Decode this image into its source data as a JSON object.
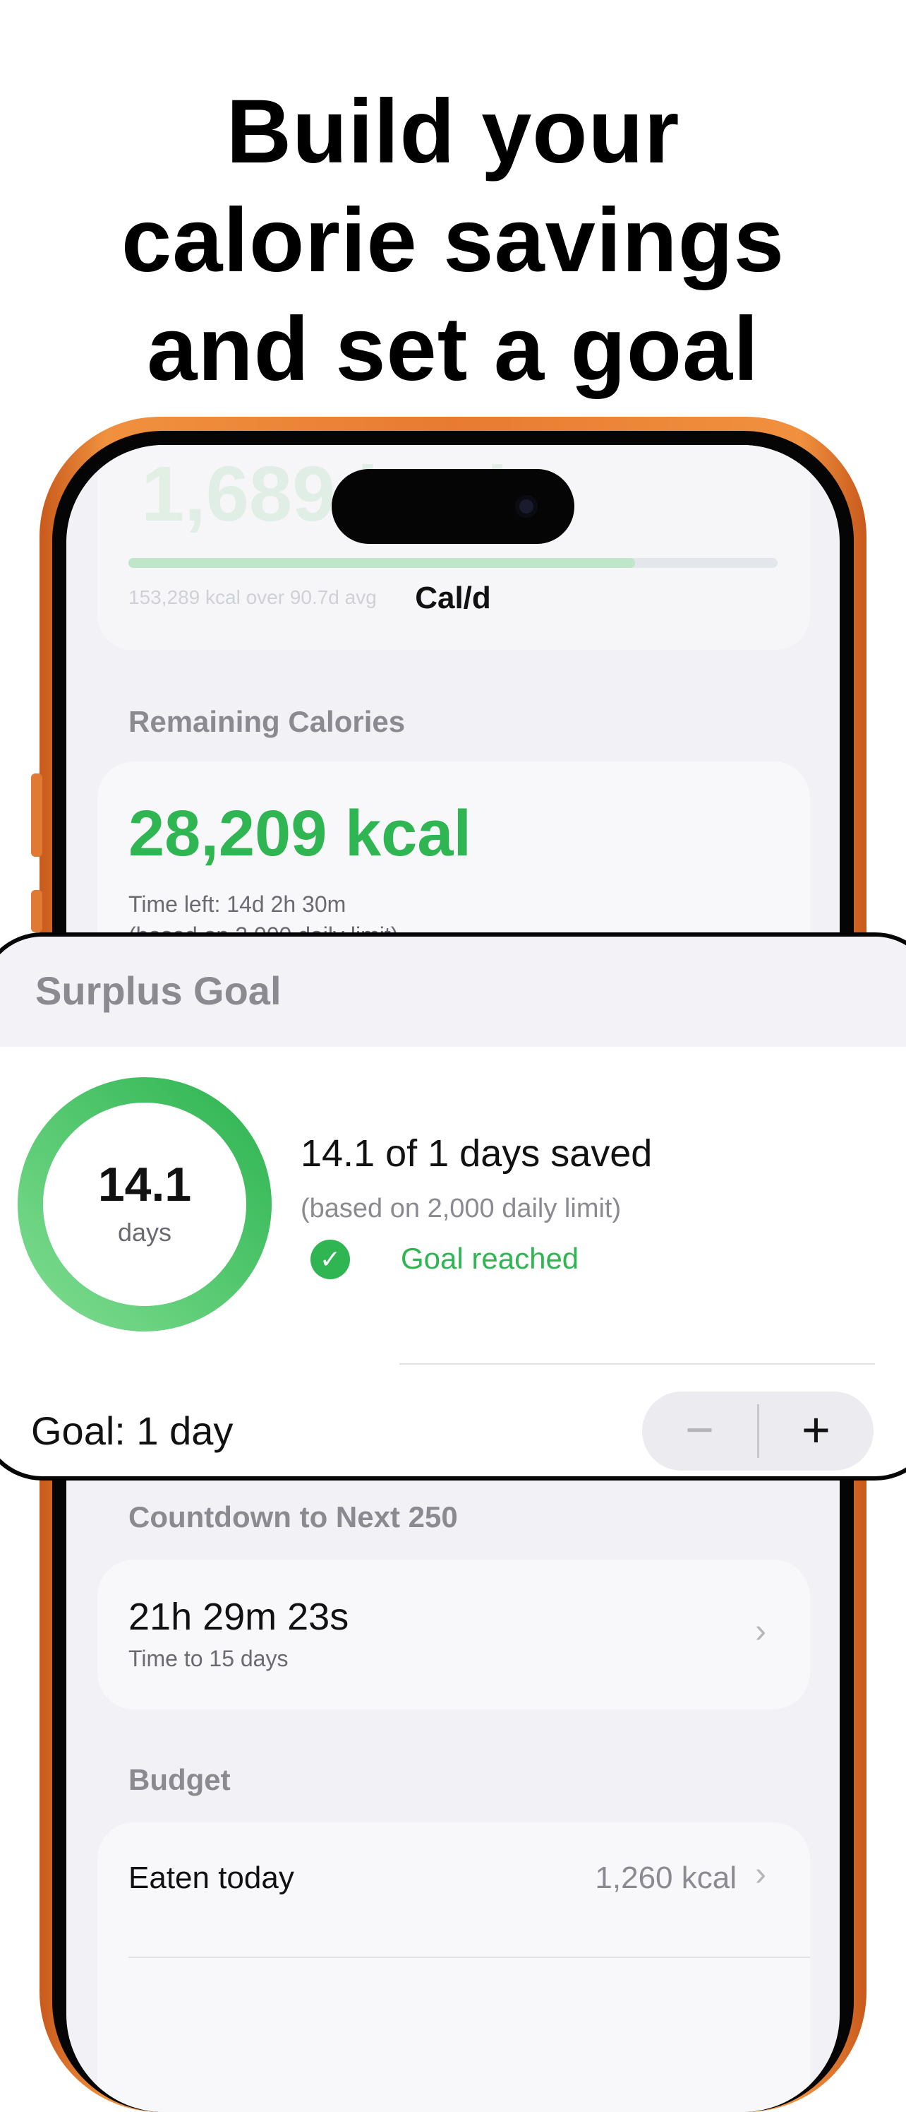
{
  "headline": [
    "Build your",
    "calorie savings",
    "and set a goal"
  ],
  "phone": {
    "ghost_value": "1,689 kcal",
    "ghost_caption": "153,289 kcal over 90.7d avg",
    "nav_title": "Cal/d",
    "remaining": {
      "label": "Remaining Calories",
      "value": "28,209 kcal",
      "time_left": "Time left: 14d 2h 30m",
      "based_on": "(based on 2,000 daily limit)"
    },
    "countdown": {
      "label": "Countdown to Next 250",
      "time": "21h 29m 23s",
      "subtitle": "Time to 15 days"
    },
    "budget": {
      "label": "Budget",
      "rows": [
        {
          "label": "Eaten today",
          "value": "1,260 kcal"
        }
      ]
    }
  },
  "surplus_goal": {
    "title": "Surplus Goal",
    "ring_value": "14.1",
    "ring_unit": "days",
    "progress_fraction": 1.0,
    "saved_text": "14.1 of 1 days saved",
    "based_text": "(based on 2,000 daily limit)",
    "status": "Goal reached",
    "goal_label": "Goal: 1 day",
    "stepper": {
      "minus": "−",
      "plus": "+"
    }
  },
  "colors": {
    "accent_green": "#2fb552",
    "phone_orange": "#e87b30"
  }
}
